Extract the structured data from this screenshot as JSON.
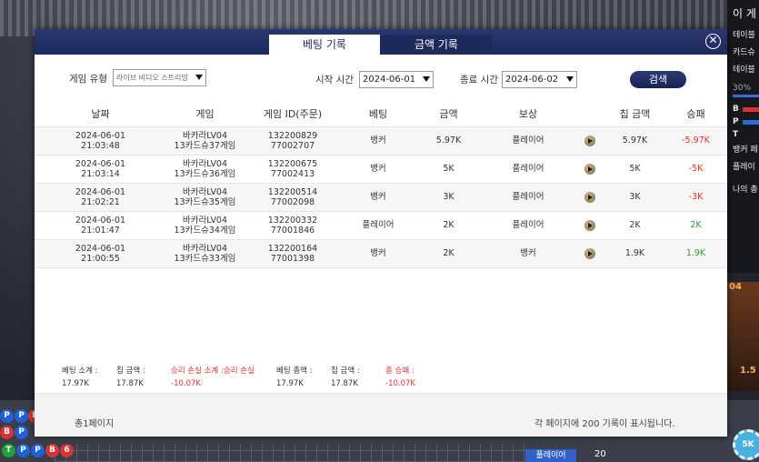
{
  "background": {
    "side_panel": {
      "title": "이 게",
      "lines": [
        "테이블",
        "카드슈",
        "테이블"
      ],
      "percent": "30%",
      "legend": [
        {
          "key": "B",
          "color": "#d93434"
        },
        {
          "key": "P",
          "color": "#2a6ad6"
        },
        {
          "key": "T",
          "color": ""
        }
      ],
      "lines2": [
        "뱅커 페",
        "플레이",
        "나의 총"
      ]
    },
    "side_orange": {
      "text1": "04",
      "text2": "1.5"
    },
    "road": [
      {
        "t": "p",
        "label": "P"
      },
      {
        "t": "p",
        "label": "P"
      },
      {
        "t": "b",
        "label": "B"
      },
      {
        "t": "b",
        "label": "B"
      },
      {
        "t": "p",
        "label": "P"
      },
      {
        "t": "t",
        "label": "T"
      },
      {
        "t": "p",
        "label": "P"
      },
      {
        "t": "p",
        "label": "P"
      },
      {
        "t": "b",
        "label": "B"
      },
      {
        "t": "b",
        "label": "6"
      }
    ],
    "player_tag": "플레이어",
    "count": "20",
    "chip": "5K"
  },
  "tabs": {
    "active": "베팅 기록",
    "inactive": "금액 기록"
  },
  "close_symbol": "✕",
  "filters": {
    "game_type_label": "게임 유형",
    "game_type_value": "라이브 비디오 스트리밍",
    "start_label": "시작 시간",
    "start_value": "2024-06-01",
    "end_label": "종료 시간",
    "end_value": "2024-06-02",
    "search_label": "검색"
  },
  "table": {
    "headers": [
      "날짜",
      "게임",
      "게임 ID(주문)",
      "베팅",
      "금액",
      "보상",
      "",
      "칩 금액",
      "승패"
    ],
    "rows": [
      {
        "date": "2024-06-01",
        "time": "21:03:48",
        "game1": "바카라LV04",
        "game2": "13카드슈37게임",
        "id1": "132200829",
        "id2": "77002707",
        "bet": "뱅커",
        "amount": "5.97K",
        "reward": "플레이어",
        "chip": "5.97K",
        "result": "-5.97K",
        "result_color": "neg"
      },
      {
        "date": "2024-06-01",
        "time": "21:03:14",
        "game1": "바카라LV04",
        "game2": "13카드슈36게임",
        "id1": "132200675",
        "id2": "77002413",
        "bet": "뱅커",
        "amount": "5K",
        "reward": "플레이어",
        "chip": "5K",
        "result": "-5K",
        "result_color": "neg"
      },
      {
        "date": "2024-06-01",
        "time": "21:02:21",
        "game1": "바카라LV04",
        "game2": "13카드슈35게임",
        "id1": "132200514",
        "id2": "77002098",
        "bet": "뱅커",
        "amount": "3K",
        "reward": "플레이어",
        "chip": "3K",
        "result": "-3K",
        "result_color": "neg"
      },
      {
        "date": "2024-06-01",
        "time": "21:01:47",
        "game1": "바카라LV04",
        "game2": "13카드슈34게임",
        "id1": "132200332",
        "id2": "77001846",
        "bet": "플레이어",
        "amount": "2K",
        "reward": "플레이어",
        "chip": "2K",
        "result": "2K",
        "result_color": "pos"
      },
      {
        "date": "2024-06-01",
        "time": "21:00:55",
        "game1": "바카라LV04",
        "game2": "13카드슈33게임",
        "id1": "132200164",
        "id2": "77001398",
        "bet": "뱅커",
        "amount": "2K",
        "reward": "뱅커",
        "chip": "1.9K",
        "result": "1.9K",
        "result_color": "pos"
      }
    ]
  },
  "summary": [
    {
      "label": "베팅 소계 :",
      "value": "17.97K",
      "red": false
    },
    {
      "label": "칩 금액 :",
      "value": "17.87K",
      "red": false
    },
    {
      "label": "승리 손실 소계 :승리 손실",
      "value": "-10.07K",
      "red": true
    },
    {
      "label": "베팅 총액 :",
      "value": "17.97K",
      "red": false
    },
    {
      "label": "칩 금액 :",
      "value": "17.87K",
      "red": false
    },
    {
      "label": "총 승패 :",
      "value": "-10.07K",
      "red": true
    }
  ],
  "footer": {
    "pages": "총1페이지",
    "per_page": "각 페이지에 200 기록이 표시됩니다."
  }
}
